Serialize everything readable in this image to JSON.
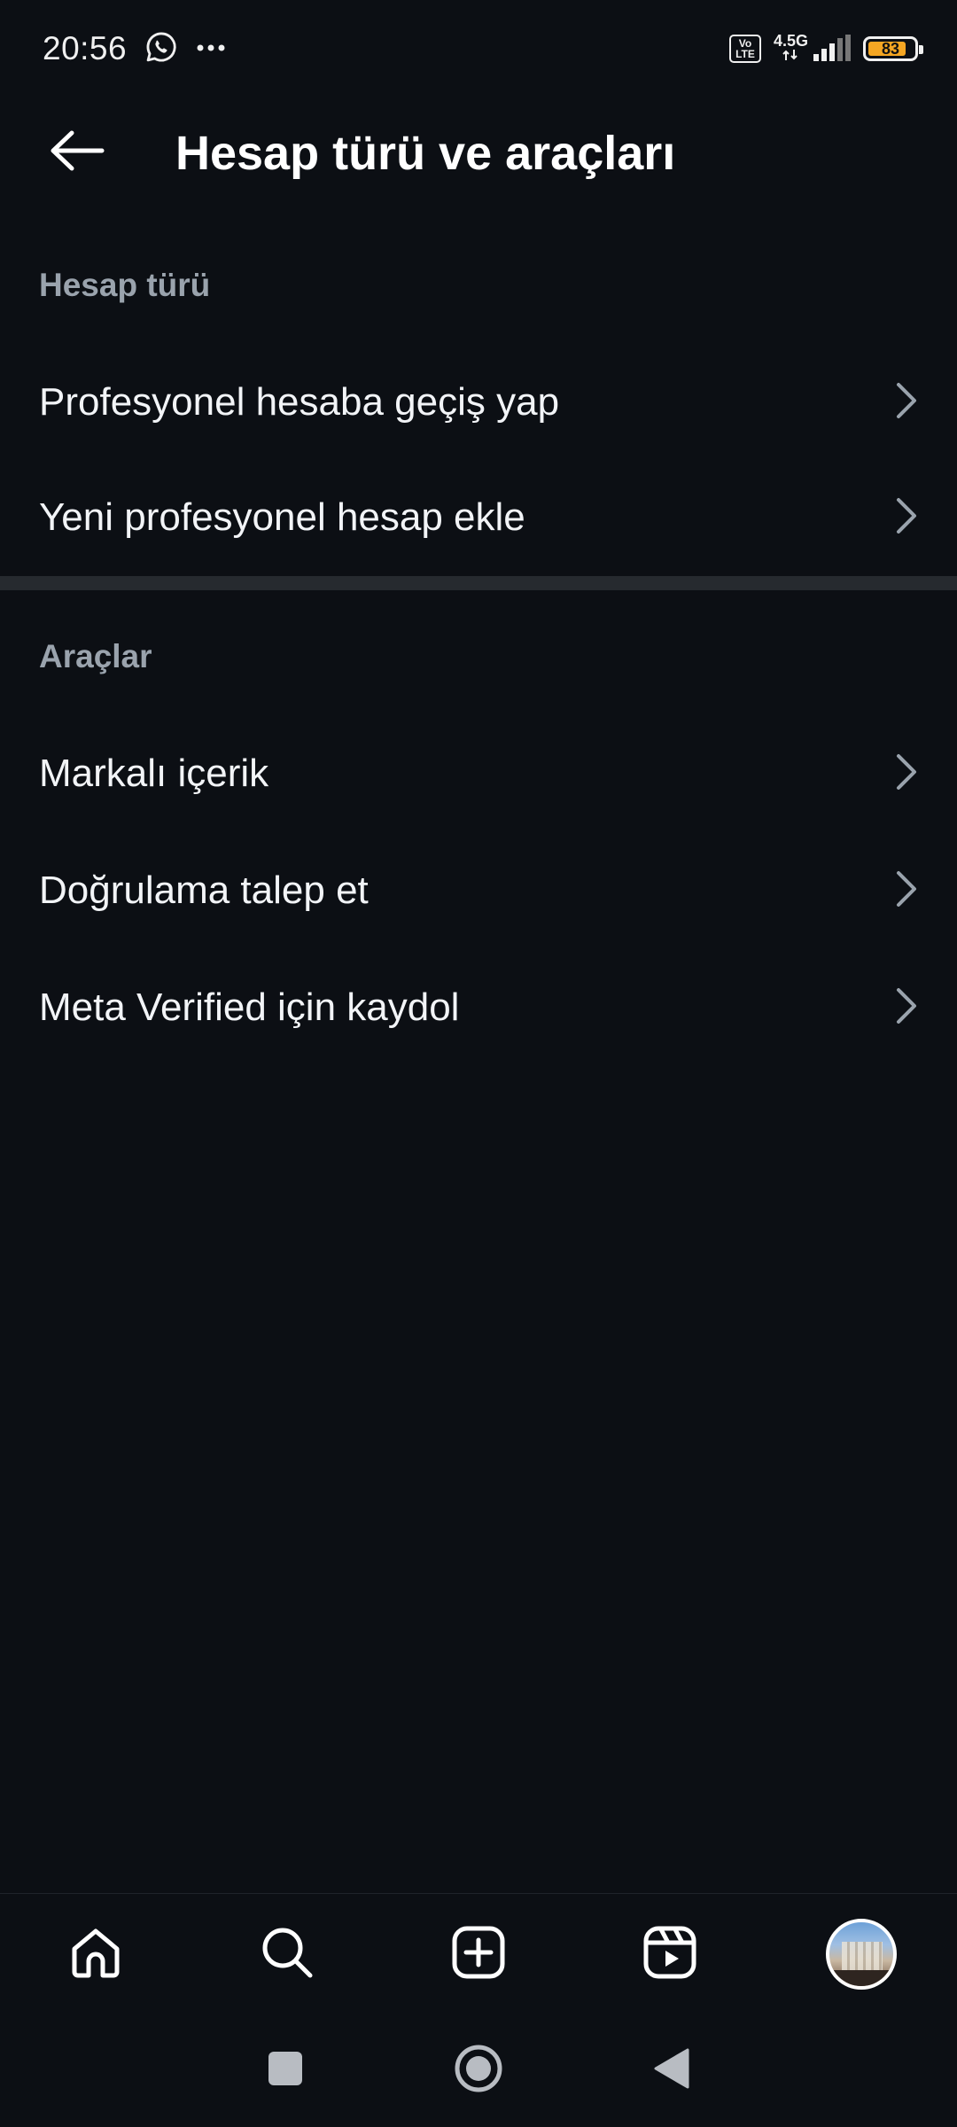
{
  "status_bar": {
    "time": "20:56",
    "volte": "Vo LTE",
    "network": "4.5G",
    "battery": "83",
    "battery_level_percent": 83,
    "battery_color": "#f5a623"
  },
  "header": {
    "title": "Hesap türü ve araçları",
    "back_icon": "arrow-left-icon"
  },
  "sections": [
    {
      "title": "Hesap türü",
      "items": [
        {
          "label": "Profesyonel hesaba geçiş yap"
        },
        {
          "label": "Yeni profesyonel hesap ekle"
        }
      ]
    },
    {
      "title": "Araçlar",
      "items": [
        {
          "label": "Markalı içerik"
        },
        {
          "label": "Doğrulama talep et"
        },
        {
          "label": "Meta Verified için kaydol"
        }
      ]
    }
  ],
  "bottom_nav": [
    "home-icon",
    "search-icon",
    "create-icon",
    "reels-icon",
    "profile-avatar"
  ],
  "system_nav": [
    "recents-square-icon",
    "home-circle-icon",
    "back-triangle-icon"
  ],
  "colors": {
    "background": "#0c0f14",
    "section_header": "#9aa3ad",
    "divider": "#262a2f"
  }
}
